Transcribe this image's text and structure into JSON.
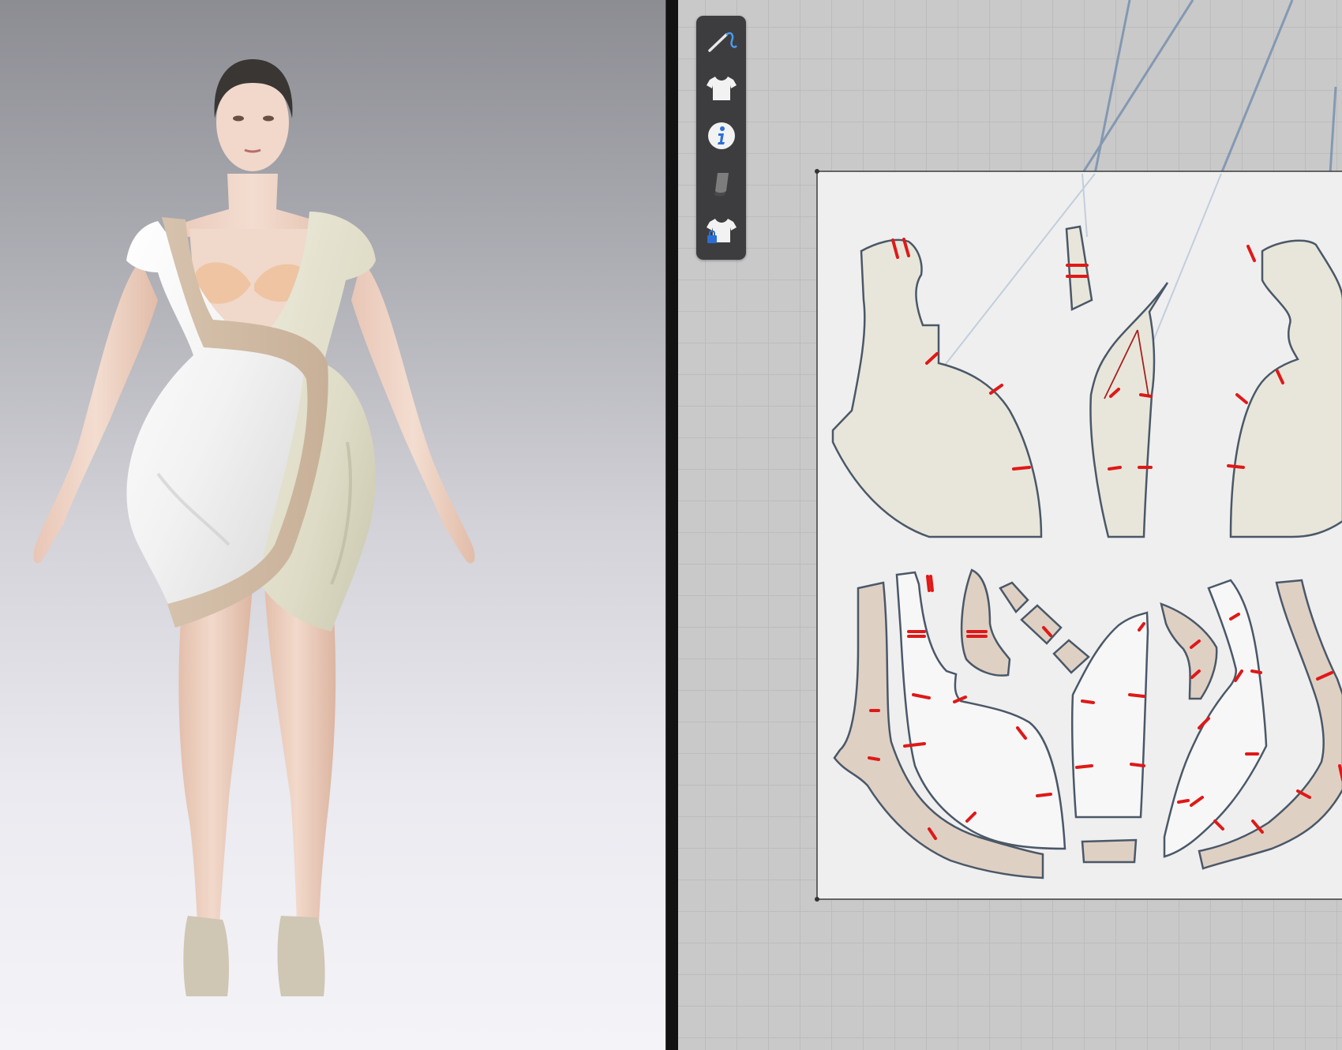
{
  "app": {
    "panels": [
      "3d-avatar-view",
      "2d-pattern-view"
    ]
  },
  "toolbar": {
    "tools": [
      {
        "name": "sewing-tool",
        "icon": "needle-thread-icon"
      },
      {
        "name": "garment-tool",
        "icon": "tshirt-icon"
      },
      {
        "name": "info-tool",
        "icon": "info-icon"
      },
      {
        "name": "fabric-tool",
        "icon": "fabric-swatch-icon"
      },
      {
        "name": "garment-lock-tool",
        "icon": "tshirt-lock-icon"
      }
    ]
  },
  "colors": {
    "toolbar_bg": "#3d3d3f",
    "pattern_beige": "#e8e6da",
    "pattern_white": "#f7f7f7",
    "pattern_tan": "#dfd0c4",
    "seam_marks": "#e01818",
    "pattern_outline": "#4a5868",
    "sewing_lines": "#6c88ab"
  },
  "pattern_pieces": [
    {
      "name": "front-bodice-left",
      "fabric": "beige"
    },
    {
      "name": "strap",
      "fabric": "beige"
    },
    {
      "name": "side-panel",
      "fabric": "beige"
    },
    {
      "name": "front-bodice-right",
      "fabric": "beige"
    },
    {
      "name": "facing-left",
      "fabric": "tan"
    },
    {
      "name": "bodice-white-left",
      "fabric": "white"
    },
    {
      "name": "facing-curve-left",
      "fabric": "tan"
    },
    {
      "name": "small-tab-1",
      "fabric": "tan"
    },
    {
      "name": "small-tab-2",
      "fabric": "tan"
    },
    {
      "name": "small-tab-3",
      "fabric": "tan"
    },
    {
      "name": "center-panel-white",
      "fabric": "white"
    },
    {
      "name": "waist-tab",
      "fabric": "tan"
    },
    {
      "name": "facing-curve-right",
      "fabric": "tan"
    },
    {
      "name": "bodice-white-right",
      "fabric": "white"
    },
    {
      "name": "facing-right",
      "fabric": "tan"
    }
  ]
}
